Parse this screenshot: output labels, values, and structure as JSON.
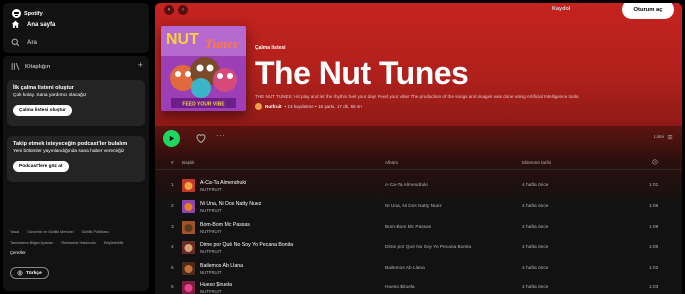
{
  "app": {
    "name": "Spotify"
  },
  "nav": {
    "home": "Ana sayfa",
    "search": "Ara"
  },
  "library": {
    "label": "Kitaplığın",
    "add": "+",
    "create_playlist": {
      "title": "İlk çalma listeni oluştur",
      "text": "Çok kolay. Sana yardımcı olacağız",
      "button": "Çalma listesi oluştur"
    },
    "podcasts": {
      "title": "Takip etmek isteyeceğin podcast'ler bulalım",
      "text": "Yeni bölümler yayınlandığında sana haber vereceğiz",
      "button": "Podcast'lere göz at"
    }
  },
  "footer": {
    "links_row1": [
      "Yasal",
      "Güvenlik ve Gizlilik Merkezi",
      "Gizlilik Politikası"
    ],
    "links_row2": [
      "Tanımlama Bilgisi Ayarları",
      "Reklamlar Hakkında",
      "Erişilebilirlik"
    ],
    "cookies": "Çerezler",
    "language": "Türkçe"
  },
  "topbar": {
    "back_icon": "‹",
    "forward_icon": "›",
    "signup": "Kaydol",
    "login": "Oturum aç"
  },
  "playlist": {
    "type": "Çalma listesi",
    "title": "The Nut Tunes",
    "description": "THE NUT TUNES: Hit play and let the rhythm fuel your day! Feed your vibe! The production of the songs and images was done using Artificial Intelligence tools.",
    "owner": "Nutfruit",
    "stats": "• 13 kaydetme • 16 şarkı, 17 dk. 55 sn",
    "cover_text": {
      "top_left": "NUT",
      "top_right": "Tunes",
      "bottom": "FEED YOUR VIBE"
    }
  },
  "actions": {
    "list_label": "Liste",
    "more": "···"
  },
  "table": {
    "headers": {
      "num": "#",
      "title": "Başlık",
      "album": "Albüm",
      "added": "Eklenme tarihi"
    },
    "rows": [
      {
        "num": "1",
        "title": "A-Ca-Ta Almendruki",
        "artist": "NUTFRUIT",
        "album": "A-Ca-Ta Almendruki",
        "added": "4 hafta önce",
        "duration": "1:01"
      },
      {
        "num": "2",
        "title": "Ni Una, Ni Dos Natty Nuez",
        "artist": "NUTFRUIT",
        "album": "Ni Una, Ni Dos Natty Nuez",
        "added": "4 hafta önce",
        "duration": "1:06"
      },
      {
        "num": "3",
        "title": "Bom-Bom Mc Passas",
        "artist": "NUTFRUIT",
        "album": "Bom-Bom Mc Passas",
        "added": "4 hafta önce",
        "duration": "1:09"
      },
      {
        "num": "4",
        "title": "Dime por Qué No Soy Yo Pecana Bonita",
        "artist": "NUTFRUIT",
        "album": "Dime por Qué No Soy Yo Pecana Bonita",
        "added": "4 hafta önce",
        "duration": "1:06"
      },
      {
        "num": "5",
        "title": "Bailemos Ab Llana",
        "artist": "NUTFRUIT",
        "album": "Bailemos Ab Llana",
        "added": "4 hafta önce",
        "duration": "1:02"
      },
      {
        "num": "6",
        "title": "Hueso $iruela",
        "artist": "NUTFRUIT",
        "album": "Hueso $iruela",
        "added": "4 hafta önce",
        "duration": "1:03"
      }
    ]
  },
  "colors": {
    "accent": "#1ed760",
    "hero": "#c5231f",
    "background": "#121212"
  }
}
